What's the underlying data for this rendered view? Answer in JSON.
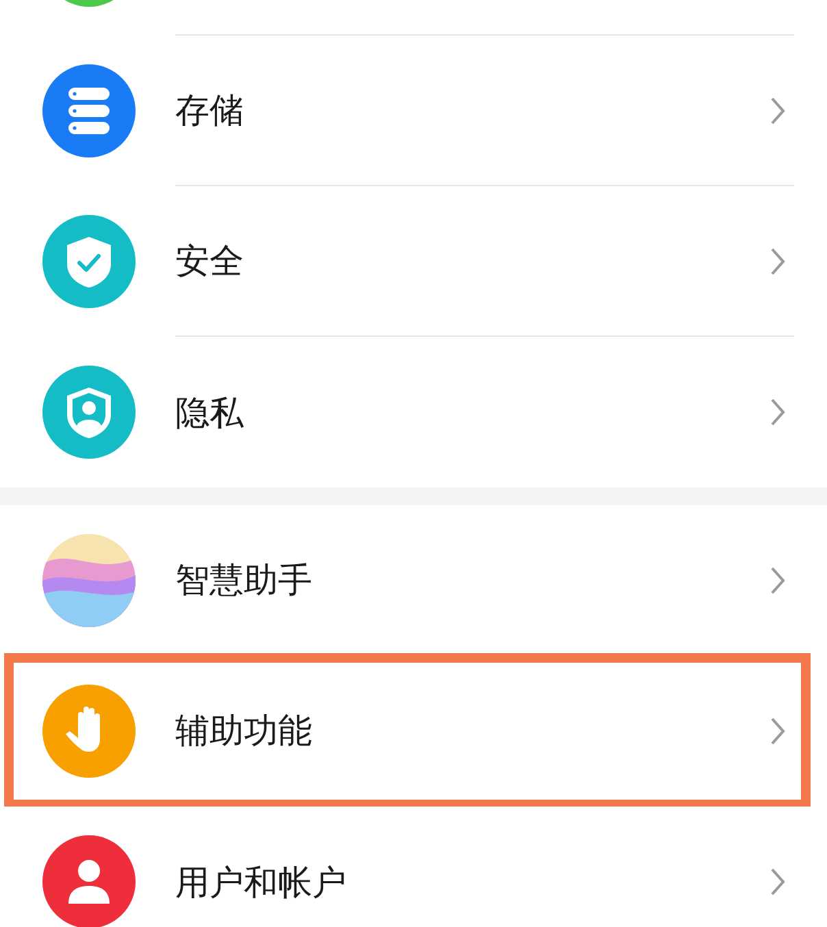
{
  "groups": [
    {
      "items": [
        {
          "kind": "cut",
          "highlighted": false
        },
        {
          "kind": "storage",
          "label": "存储",
          "highlighted": false
        },
        {
          "kind": "security",
          "label": "安全",
          "highlighted": false
        },
        {
          "kind": "privacy",
          "label": "隐私",
          "highlighted": false
        }
      ]
    },
    {
      "items": [
        {
          "kind": "assistant",
          "label": "智慧助手",
          "highlighted": false
        },
        {
          "kind": "accessibility",
          "label": "辅助功能",
          "highlighted": true
        },
        {
          "kind": "account",
          "label": "用户和帐户",
          "highlighted": false
        }
      ]
    }
  ]
}
